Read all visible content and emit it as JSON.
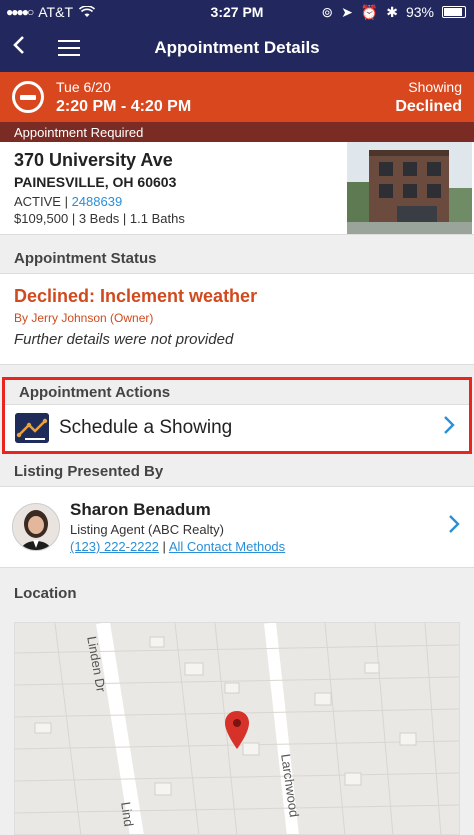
{
  "status_bar": {
    "carrier": "AT&T",
    "time": "3:27 PM",
    "battery": "93%"
  },
  "nav": {
    "title": "Appointment Details"
  },
  "banner": {
    "date": "Tue 6/20",
    "time_range": "2:20 PM - 4:20 PM",
    "type": "Showing",
    "state": "Declined",
    "required": "Appointment Required"
  },
  "property": {
    "address_line1": "370 University Ave",
    "address_line2": "PAINESVILLE, OH 60603",
    "status_label": "ACTIVE |",
    "mls_number": "2488639",
    "details": "$109,500 | 3 Beds | 1.1 Baths"
  },
  "status_section": {
    "heading": "Appointment Status",
    "result": "Declined: Inclement weather",
    "by": "By Jerry Johnson (Owner)",
    "note": "Further details were not provided"
  },
  "actions_section": {
    "heading": "Appointment Actions",
    "item_label": "Schedule a Showing"
  },
  "listing_section": {
    "heading": "Listing Presented By",
    "agent_name": "Sharon Benadum",
    "agent_role": "Listing Agent (ABC Realty)",
    "phone": "(123) 222-2222",
    "separator": "|",
    "contact_link": "All Contact Methods"
  },
  "location_section": {
    "heading": "Location",
    "street_1": "Linden Dr",
    "street_2": "Larchwood",
    "street_3": "Lind"
  },
  "colors": {
    "navy": "#22285e",
    "declined_orange": "#d9471e",
    "link_blue": "#2a8fd6",
    "highlight_red": "#e8261f"
  }
}
